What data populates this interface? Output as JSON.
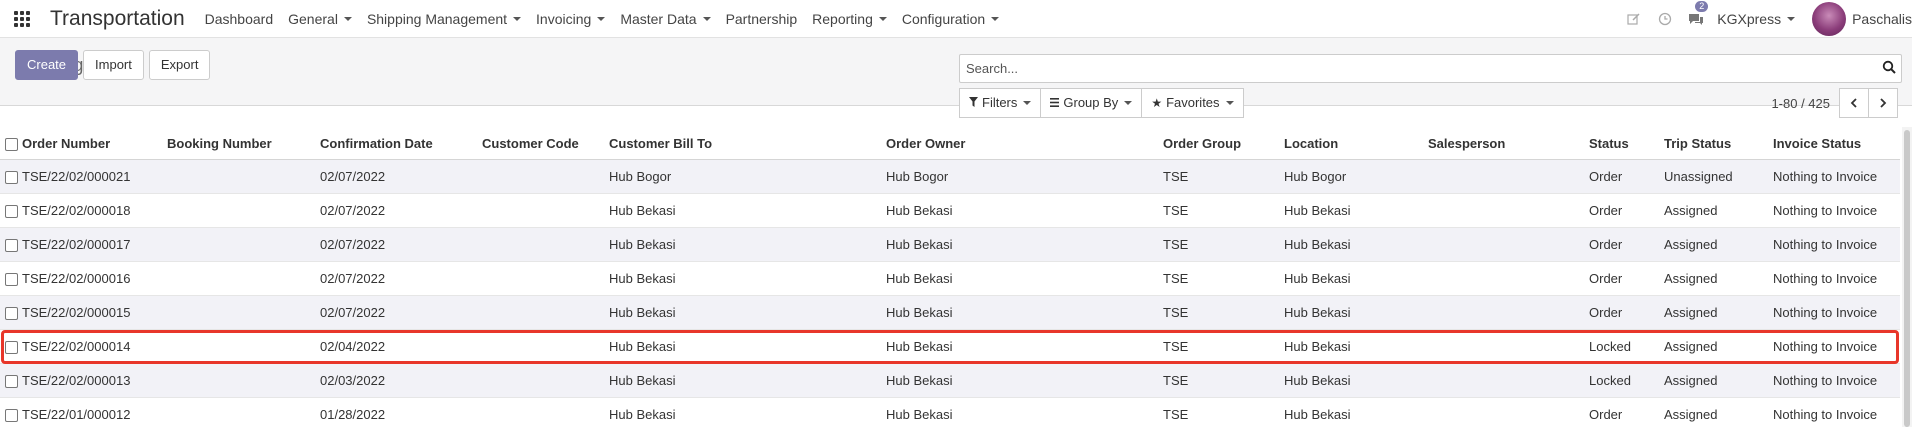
{
  "navbar": {
    "brand": "Transportation",
    "menu": [
      {
        "label": "Dashboard",
        "dropdown": false
      },
      {
        "label": "General",
        "dropdown": true
      },
      {
        "label": "Shipping Management",
        "dropdown": true
      },
      {
        "label": "Invoicing",
        "dropdown": true
      },
      {
        "label": "Master Data",
        "dropdown": true
      },
      {
        "label": "Partnership",
        "dropdown": false
      },
      {
        "label": "Reporting",
        "dropdown": true
      },
      {
        "label": "Configuration",
        "dropdown": true
      }
    ],
    "messages_badge": "2",
    "company": "KGXpress",
    "user": "Paschalis"
  },
  "control_panel": {
    "title": "Trucking Orders",
    "create_label": "Create",
    "import_label": "Import",
    "export_label": "Export",
    "search_placeholder": "Search...",
    "filters_label": "Filters",
    "groupby_label": "Group By",
    "favorites_label": "Favorites",
    "pager_value": "1-80 / 425"
  },
  "table": {
    "columns": [
      "Order Number",
      "Booking Number",
      "Confirmation Date",
      "Customer Code",
      "Customer Bill To",
      "Order Owner",
      "Order Group",
      "Location",
      "Salesperson",
      "Status",
      "Trip Status",
      "Invoice Status"
    ],
    "rows": [
      [
        "TSE/22/02/000021",
        "",
        "02/07/2022",
        "",
        "Hub Bogor",
        "Hub Bogor",
        "TSE",
        "Hub Bogor",
        "",
        "Order",
        "Unassigned",
        "Nothing to Invoice"
      ],
      [
        "TSE/22/02/000018",
        "",
        "02/07/2022",
        "",
        "Hub Bekasi",
        "Hub Bekasi",
        "TSE",
        "Hub Bekasi",
        "",
        "Order",
        "Assigned",
        "Nothing to Invoice"
      ],
      [
        "TSE/22/02/000017",
        "",
        "02/07/2022",
        "",
        "Hub Bekasi",
        "Hub Bekasi",
        "TSE",
        "Hub Bekasi",
        "",
        "Order",
        "Assigned",
        "Nothing to Invoice"
      ],
      [
        "TSE/22/02/000016",
        "",
        "02/07/2022",
        "",
        "Hub Bekasi",
        "Hub Bekasi",
        "TSE",
        "Hub Bekasi",
        "",
        "Order",
        "Assigned",
        "Nothing to Invoice"
      ],
      [
        "TSE/22/02/000015",
        "",
        "02/07/2022",
        "",
        "Hub Bekasi",
        "Hub Bekasi",
        "TSE",
        "Hub Bekasi",
        "",
        "Order",
        "Assigned",
        "Nothing to Invoice"
      ],
      [
        "TSE/22/02/000014",
        "",
        "02/04/2022",
        "",
        "Hub Bekasi",
        "Hub Bekasi",
        "TSE",
        "Hub Bekasi",
        "",
        "Locked",
        "Assigned",
        "Nothing to Invoice"
      ],
      [
        "TSE/22/02/000013",
        "",
        "02/03/2022",
        "",
        "Hub Bekasi",
        "Hub Bekasi",
        "TSE",
        "Hub Bekasi",
        "",
        "Locked",
        "Assigned",
        "Nothing to Invoice"
      ],
      [
        "TSE/22/01/000012",
        "",
        "01/28/2022",
        "",
        "Hub Bekasi",
        "Hub Bekasi",
        "TSE",
        "Hub Bekasi",
        "",
        "Order",
        "Assigned",
        "Nothing to Invoice"
      ]
    ],
    "highlighted_row": 5
  },
  "colors": {
    "brand": "#7c7bad",
    "highlight": "#e8362a"
  }
}
